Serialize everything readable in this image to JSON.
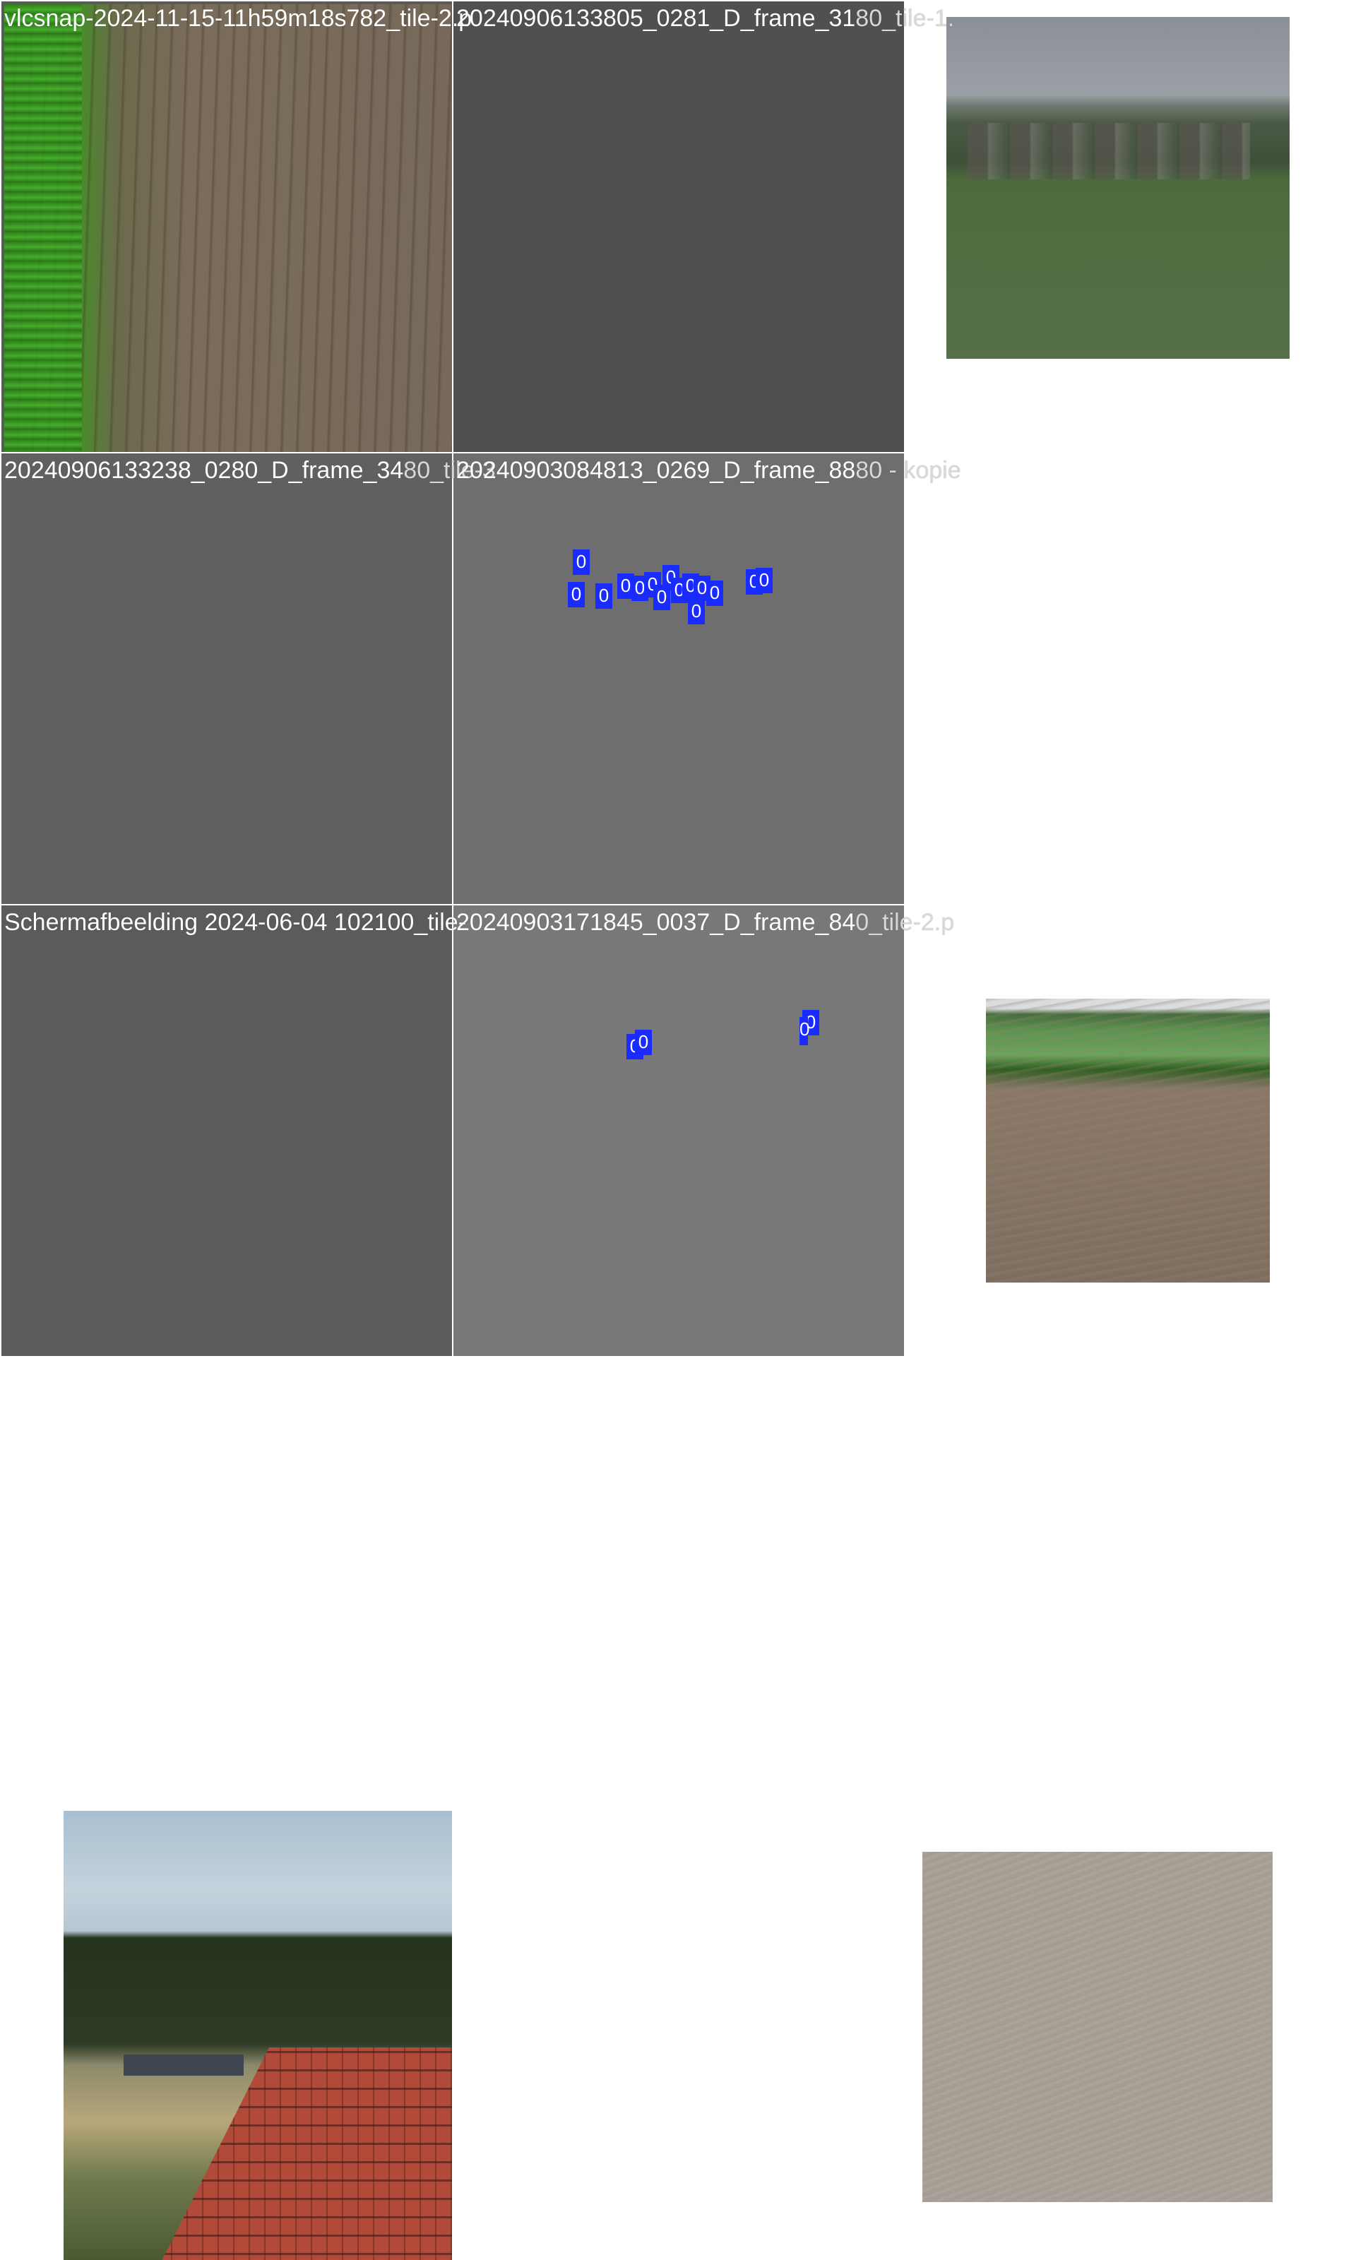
{
  "tiles": [
    {
      "title_visible": "vlcsnap-2024-11-15-11h59m18s782_tile-2.p"
    },
    {
      "title_visible": "20240906133805_0281_D_frame_31",
      "title_overflow": "80_tile-1."
    },
    {
      "title_visible": "20240906133238_0280_D_frame_34",
      "title_overflow": "80_tile-3"
    },
    {
      "title_visible": "20240903084813_0269_D_frame_88",
      "title_overflow": "80 - kopie",
      "detection_label": "0",
      "detection_count": 15
    },
    {
      "title_visible": "Schermafbeelding 2024-06-04 102100_tile-"
    },
    {
      "title_visible": "20240903171845_0037_D_frame_84",
      "title_overflow": "0_tile-2.p",
      "detection_label": "0",
      "detection_count": 4
    }
  ],
  "colors": {
    "detection_box": "#1a2bff",
    "label_text": "#ffffff"
  }
}
